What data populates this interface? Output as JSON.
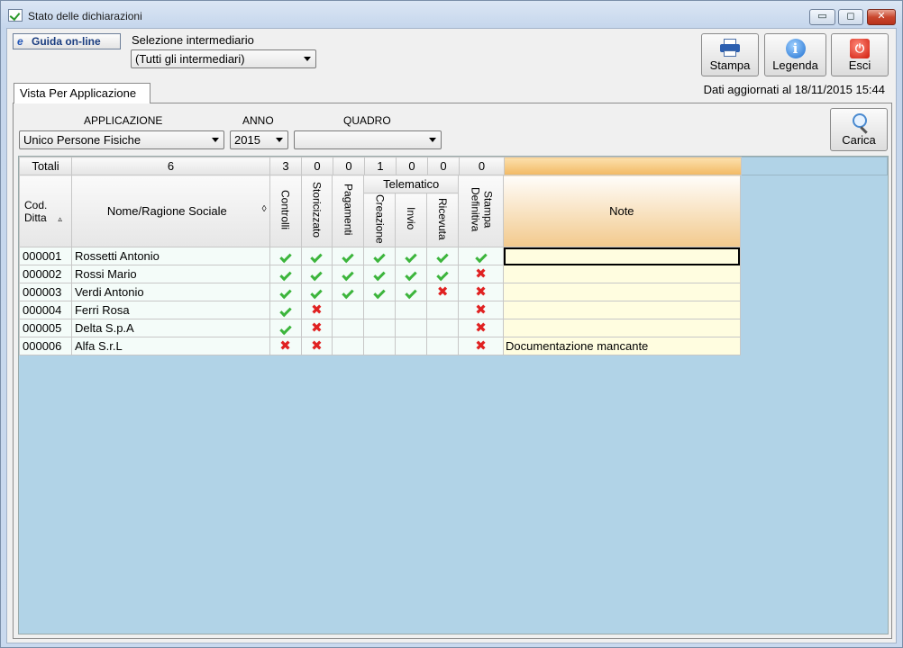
{
  "window": {
    "title": "Stato delle dichiarazioni",
    "min": "▭",
    "max": "◻",
    "close": "✕"
  },
  "toolbar": {
    "guida_label": "Guida on-line",
    "guida_icon": "ie-icon",
    "selezione_label": "Selezione intermediario",
    "selezione_value": "(Tutti gli intermediari)",
    "stampa": "Stampa",
    "legenda": "Legenda",
    "esci": "Esci",
    "dati": "Dati aggiornati al 18/11/2015 15:44"
  },
  "tab": {
    "label": "Vista Per Applicazione"
  },
  "filters": {
    "applicazione_label": "APPLICAZIONE",
    "applicazione_value": "Unico Persone Fisiche",
    "anno_label": "ANNO",
    "anno_value": "2015",
    "quadro_label": "QUADRO",
    "quadro_value": "",
    "carica": "Carica"
  },
  "grid": {
    "headers": {
      "cod": "Cod. Ditta",
      "nome": "Nome/Ragione Sociale",
      "controlli": "Controlli",
      "storicizzato": "Storicizzato",
      "pagamenti": "Pagamenti",
      "telematico": "Telematico",
      "creazione": "Creazione",
      "invio": "Invio",
      "ricevuta": "Ricevuta",
      "stampa_def": "Stampa Definitiva",
      "note": "Note"
    },
    "rows": [
      {
        "cod": "000001",
        "nome": "Rossetti Antonio",
        "marks": [
          "ok",
          "ok",
          "ok",
          "ok",
          "ok",
          "ok",
          "ok"
        ],
        "note": ""
      },
      {
        "cod": "000002",
        "nome": "Rossi Mario",
        "marks": [
          "ok",
          "ok",
          "ok",
          "ok",
          "ok",
          "ok",
          "ko"
        ],
        "note": ""
      },
      {
        "cod": "000003",
        "nome": "Verdi Antonio",
        "marks": [
          "ok",
          "ok",
          "ok",
          "ok",
          "ok",
          "ko",
          "ko"
        ],
        "note": ""
      },
      {
        "cod": "000004",
        "nome": "Ferri Rosa",
        "marks": [
          "ok",
          "ko",
          "",
          "",
          "",
          "",
          "ko"
        ],
        "note": ""
      },
      {
        "cod": "000005",
        "nome": "Delta S.p.A",
        "marks": [
          "ok",
          "ko",
          "",
          "",
          "",
          "",
          "ko"
        ],
        "note": ""
      },
      {
        "cod": "000006",
        "nome": "Alfa S.r.L",
        "marks": [
          "ko",
          "ko",
          "",
          "",
          "",
          "",
          "ko"
        ],
        "note": "Documentazione mancante"
      }
    ],
    "totals": {
      "label": "Totali",
      "count": "6",
      "values": [
        "3",
        "0",
        "0",
        "1",
        "0",
        "0",
        "0"
      ]
    }
  }
}
